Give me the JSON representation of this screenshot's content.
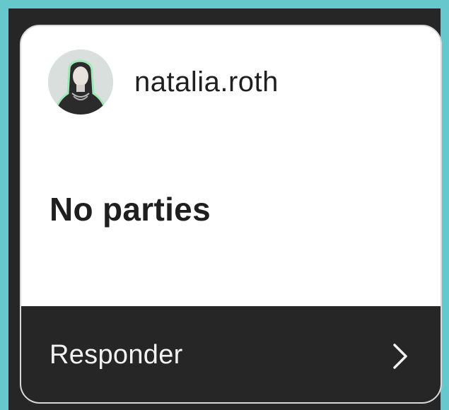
{
  "card": {
    "username": "natalia.roth",
    "headline": "No parties",
    "action_label": "Responder"
  },
  "icons": {
    "avatar": "profile-photo",
    "action": "chevron-right-icon"
  },
  "colors": {
    "border_accent": "#66c8cc",
    "background": "#262626",
    "card": "#ffffff",
    "text_dark": "#1f1f1f",
    "text_light": "#f2f2f2"
  }
}
